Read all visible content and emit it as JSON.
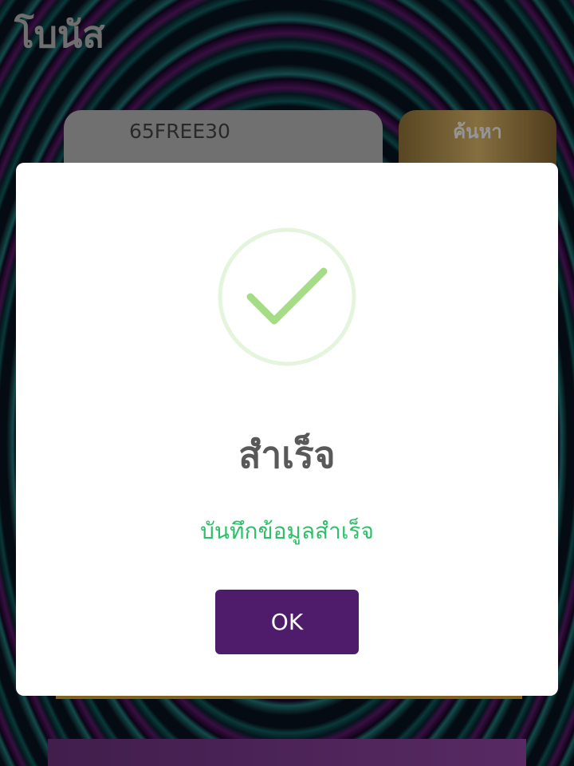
{
  "header": {
    "title": "โบนัส"
  },
  "search": {
    "code_value": "65FREE30",
    "button_label": "ค้นหา"
  },
  "modal": {
    "icon": "checkmark-icon",
    "title": "สำเร็จ",
    "message": "บันทึกข้อมูลสำเร็จ",
    "ok_label": "OK"
  },
  "colors": {
    "check_stroke": "#a5dc86",
    "check_ring": "#e5f4dc",
    "message_text": "#2fbf6a",
    "ok_button": "#4f1b6b"
  }
}
